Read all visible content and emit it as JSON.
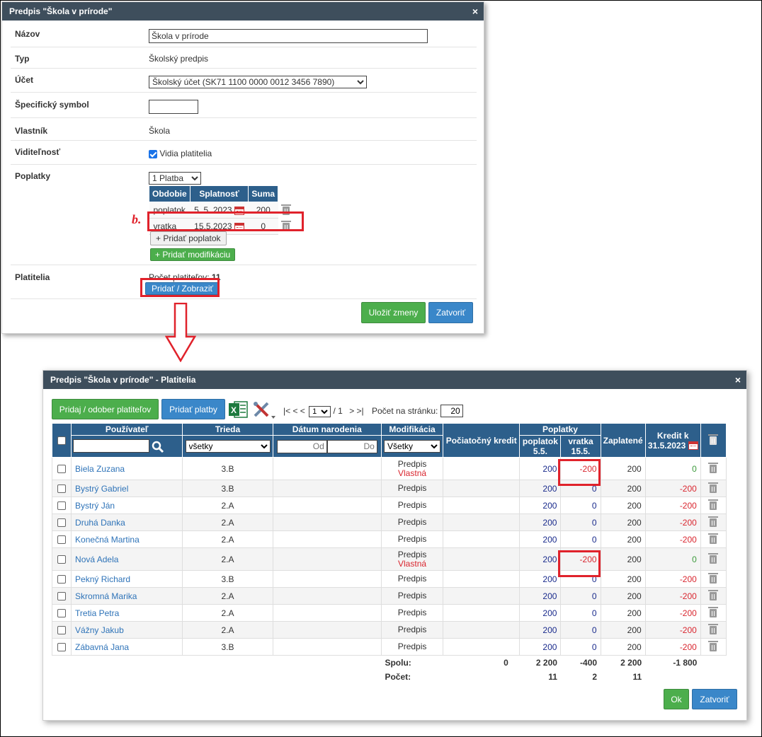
{
  "dialog1": {
    "title": "Predpis \"Škola v prírode\"",
    "close": "×",
    "fields": {
      "nazov_label": "Názov",
      "nazov_value": "Škola v prírode",
      "typ_label": "Typ",
      "typ_value": "Školský predpis",
      "ucet_label": "Účet",
      "ucet_value": "Školský účet (SK71 1100 0000 0012 3456 7890)",
      "spec_label": "Špecifický symbol",
      "spec_value": "",
      "vlastnik_label": "Vlastník",
      "vlastnik_value": "Škola",
      "viditelnost_label": "Viditeľnosť",
      "viditelnost_value": "Vidia platitelia",
      "poplatky_label": "Poplatky",
      "platba_select": "1 Platba",
      "platitelia_label": "Platitelia",
      "pocet_label": "Počet platiteľov:",
      "pocet_value": "11"
    },
    "fee_table": {
      "headers": [
        "Obdobie",
        "Splatnosť",
        "Suma"
      ],
      "rows": [
        {
          "obdobie": "poplatok",
          "datum": "5. 5. 2023",
          "suma": "200"
        },
        {
          "obdobie": "vratka",
          "datum": "15.5.2023",
          "suma": "0"
        }
      ]
    },
    "buttons": {
      "add_fee": "+ Pridať poplatok",
      "add_mod": "+ Pridať modifikáciu",
      "add_show": "Pridať / Zobraziť",
      "save": "Uložiť zmeny",
      "close": "Zatvoriť"
    },
    "callout": "b."
  },
  "dialog2": {
    "title": "Predpis \"Škola v prírode\" - Platitelia",
    "close": "×",
    "toolbar": {
      "add_remove": "Pridaj / odober platiteľov",
      "add_payments": "Pridať platby",
      "pager_nav_left": "|< < <",
      "page_value": "1",
      "page_total": "/ 1",
      "pager_nav_right": "> >|",
      "per_page_label": "Počet na stránku:",
      "per_page_value": "20"
    },
    "headers": {
      "user": "Používateľ",
      "class": "Trieda",
      "dob": "Dátum narodenia",
      "mod": "Modifikácia",
      "initial_credit": "Počiatočný kredit",
      "fees": "Poplatky",
      "fee1a": "poplatok",
      "fee1b": "5.5.",
      "fee2a": "vratka",
      "fee2b": "15.5.",
      "paid": "Zaplatené",
      "credit_a": "Kredit k",
      "credit_b": "31.5.2023",
      "class_filter": "všetky",
      "dob_from": "Od",
      "dob_to": "Do",
      "mod_filter": "Všetky"
    },
    "rows": [
      {
        "name": "Biela Zuzana",
        "class": "3.B",
        "mod1": "Predpis",
        "mod2": "Vlastná",
        "fee1": "200",
        "fee2": "-200",
        "paid": "200",
        "credit": "0"
      },
      {
        "name": "Bystrý Gabriel",
        "class": "3.B",
        "mod1": "Predpis",
        "mod2": "",
        "fee1": "200",
        "fee2": "0",
        "paid": "200",
        "credit": "-200"
      },
      {
        "name": "Bystrý Ján",
        "class": "2.A",
        "mod1": "Predpis",
        "mod2": "",
        "fee1": "200",
        "fee2": "0",
        "paid": "200",
        "credit": "-200"
      },
      {
        "name": "Druhá Danka",
        "class": "2.A",
        "mod1": "Predpis",
        "mod2": "",
        "fee1": "200",
        "fee2": "0",
        "paid": "200",
        "credit": "-200"
      },
      {
        "name": "Konečná Martina",
        "class": "2.A",
        "mod1": "Predpis",
        "mod2": "",
        "fee1": "200",
        "fee2": "0",
        "paid": "200",
        "credit": "-200"
      },
      {
        "name": "Nová Adela",
        "class": "2.A",
        "mod1": "Predpis",
        "mod2": "Vlastná",
        "fee1": "200",
        "fee2": "-200",
        "paid": "200",
        "credit": "0"
      },
      {
        "name": "Pekný Richard",
        "class": "3.B",
        "mod1": "Predpis",
        "mod2": "",
        "fee1": "200",
        "fee2": "0",
        "paid": "200",
        "credit": "-200"
      },
      {
        "name": "Skromná Marika",
        "class": "2.A",
        "mod1": "Predpis",
        "mod2": "",
        "fee1": "200",
        "fee2": "0",
        "paid": "200",
        "credit": "-200"
      },
      {
        "name": "Tretia Petra",
        "class": "2.A",
        "mod1": "Predpis",
        "mod2": "",
        "fee1": "200",
        "fee2": "0",
        "paid": "200",
        "credit": "-200"
      },
      {
        "name": "Vážny Jakub",
        "class": "2.A",
        "mod1": "Predpis",
        "mod2": "",
        "fee1": "200",
        "fee2": "0",
        "paid": "200",
        "credit": "-200"
      },
      {
        "name": "Zábavná Jana",
        "class": "3.B",
        "mod1": "Predpis",
        "mod2": "",
        "fee1": "200",
        "fee2": "0",
        "paid": "200",
        "credit": "-200"
      }
    ],
    "summary": {
      "spolu_label": "Spolu:",
      "spolu_initial": "0",
      "spolu_fee1": "2 200",
      "spolu_fee2": "-400",
      "spolu_paid": "2 200",
      "spolu_credit": "-1 800",
      "pocet_label": "Počet:",
      "pocet_fee1": "11",
      "pocet_fee2": "2",
      "pocet_paid": "11"
    },
    "buttons": {
      "ok": "Ok",
      "close": "Zatvoriť"
    }
  },
  "colors": {
    "header_bar": "#3e4e5c",
    "table_header": "#2d5f8b",
    "green_button": "#4cae4c",
    "blue_button": "#3a87c9",
    "highlight_red": "#e0222b",
    "link_blue": "#2e73b8"
  },
  "icons": [
    "close-icon",
    "calendar-icon",
    "trash-icon",
    "search-icon",
    "excel-icon",
    "tools-icon",
    "down-arrow-icon"
  ]
}
